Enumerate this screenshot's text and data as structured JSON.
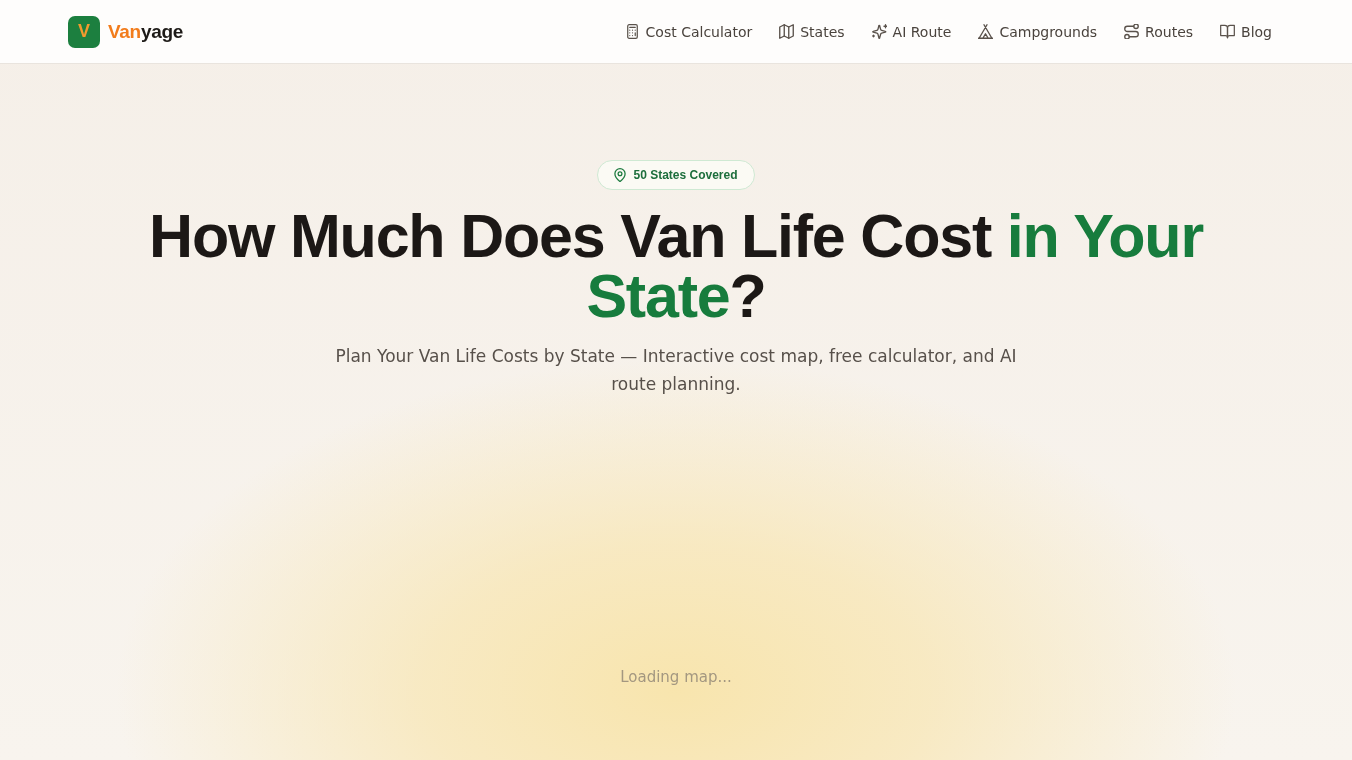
{
  "brand": {
    "mark": "V",
    "accent": "Van",
    "rest": "yage"
  },
  "nav": [
    {
      "label": "Cost Calculator"
    },
    {
      "label": "States"
    },
    {
      "label": "AI Route"
    },
    {
      "label": "Campgrounds"
    },
    {
      "label": "Routes"
    },
    {
      "label": "Blog"
    }
  ],
  "hero": {
    "badge": "50 States Covered",
    "title_parts": [
      {
        "text": "How Much Does Van Life Cost ",
        "highlight": false
      },
      {
        "text": "in Your State",
        "highlight": true
      },
      {
        "text": "?",
        "highlight": false
      }
    ],
    "subtitle": "Plan Your Van Life Costs by State — Interactive cost map, free calculator, and AI route planning."
  },
  "map": {
    "status": "Loading map..."
  }
}
